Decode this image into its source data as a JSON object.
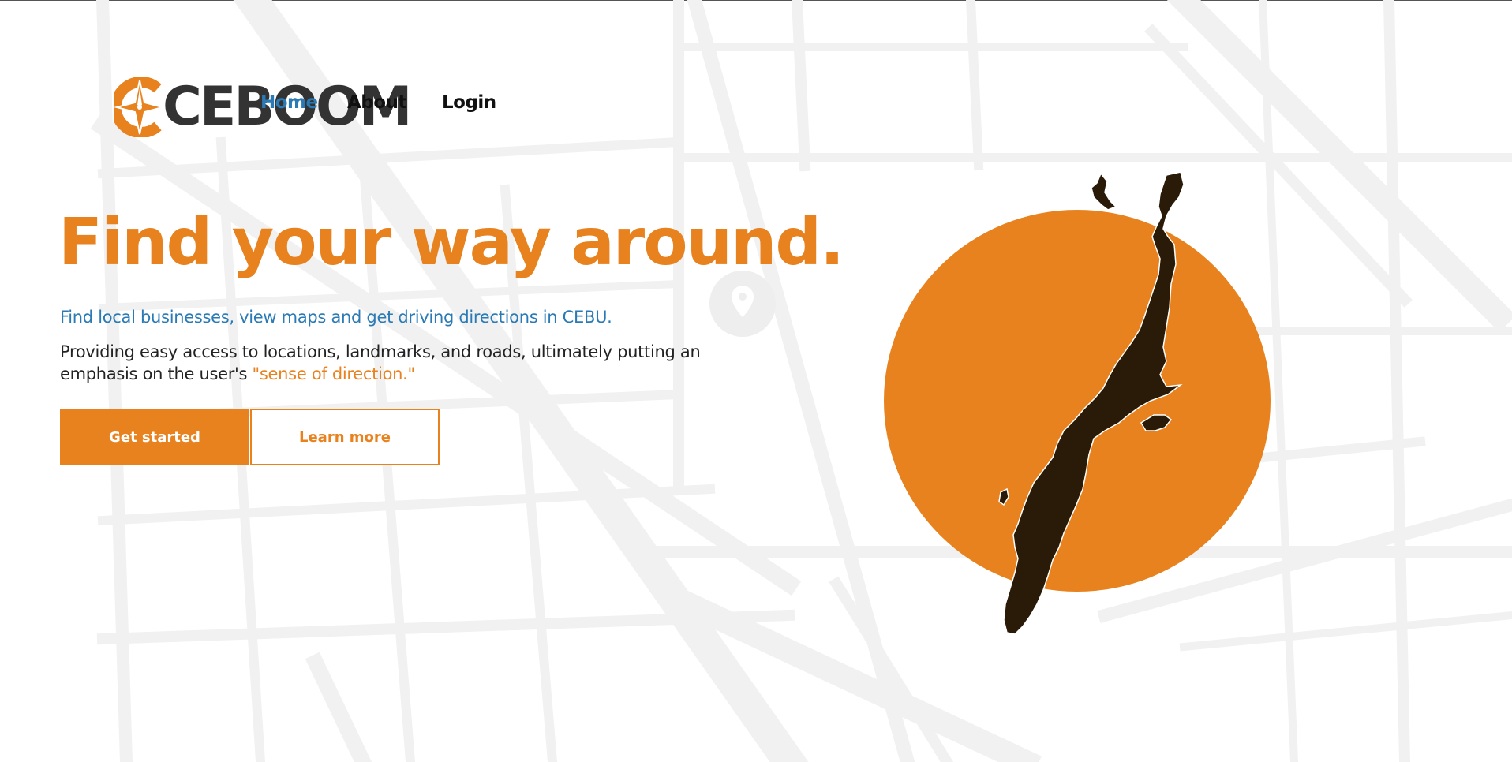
{
  "brand": {
    "name": "CEBOOM",
    "logo_letter": "C",
    "accent_color": "#e8821e",
    "link_color": "#2a7ab5",
    "text_color": "#333333"
  },
  "nav": {
    "items": [
      {
        "label": "Home",
        "active": true
      },
      {
        "label": "About",
        "active": false
      },
      {
        "label": "Login",
        "active": false
      }
    ]
  },
  "hero": {
    "title": "Find your way around.",
    "subtitle": "Find local businesses, view maps and get driving directions in CEBU.",
    "description_start": "Providing easy access to locations, landmarks, and roads, ultimately putting an emphasis on the user's ",
    "description_accent": "\"sense of direction.\"",
    "buttons": {
      "primary": "Get started",
      "secondary": "Learn more"
    }
  },
  "illustration": {
    "circle_color": "#e8821e",
    "island_color": "#2a1a08",
    "icon": "cebu-island-map-icon"
  }
}
